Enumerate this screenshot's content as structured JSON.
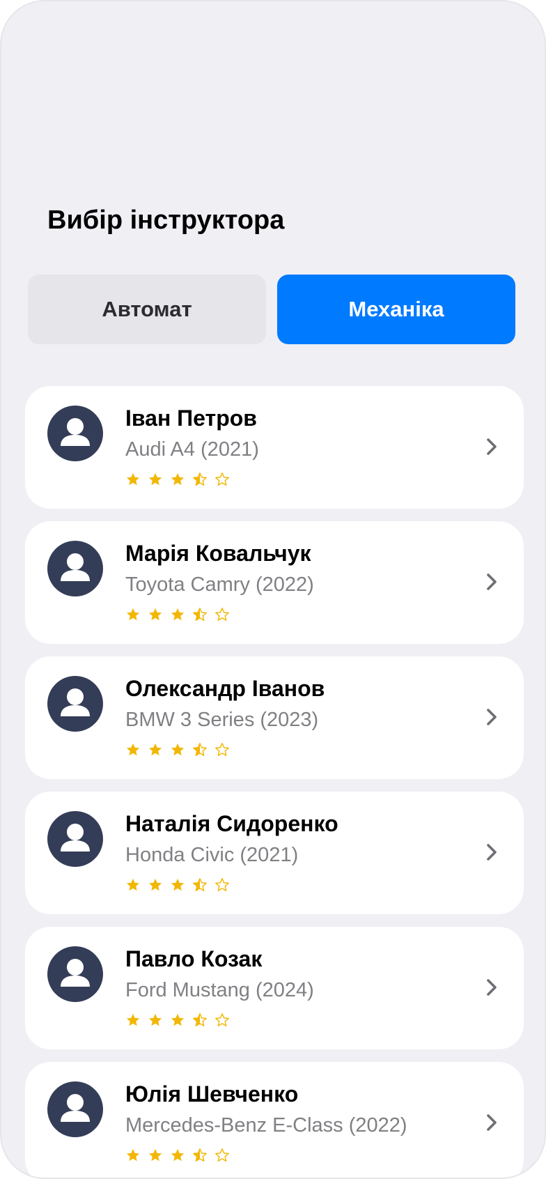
{
  "screen": {
    "title": "Вибір інструктора"
  },
  "transmission": {
    "options": [
      "Автомат",
      "Механіка"
    ],
    "selected": "Механіка",
    "accent_color": "#007aff"
  },
  "rating_color": "#f2b705",
  "instructors": [
    {
      "name": "Іван Петров",
      "car": "Audi A4 (2021)",
      "rating": 3.5,
      "max_rating": 5
    },
    {
      "name": "Марія Ковальчук",
      "car": "Toyota Camry (2022)",
      "rating": 3.5,
      "max_rating": 5
    },
    {
      "name": "Олександр Іванов",
      "car": "BMW 3 Series (2023)",
      "rating": 3.5,
      "max_rating": 5
    },
    {
      "name": "Наталія Сидоренко",
      "car": "Honda Civic (2021)",
      "rating": 3.5,
      "max_rating": 5
    },
    {
      "name": "Павло Козак",
      "car": "Ford Mustang (2024)",
      "rating": 3.5,
      "max_rating": 5
    },
    {
      "name": "Юлія Шевченко",
      "car": "Mercedes-Benz E-Class (2022)",
      "rating": 3.5,
      "max_rating": 5
    }
  ]
}
